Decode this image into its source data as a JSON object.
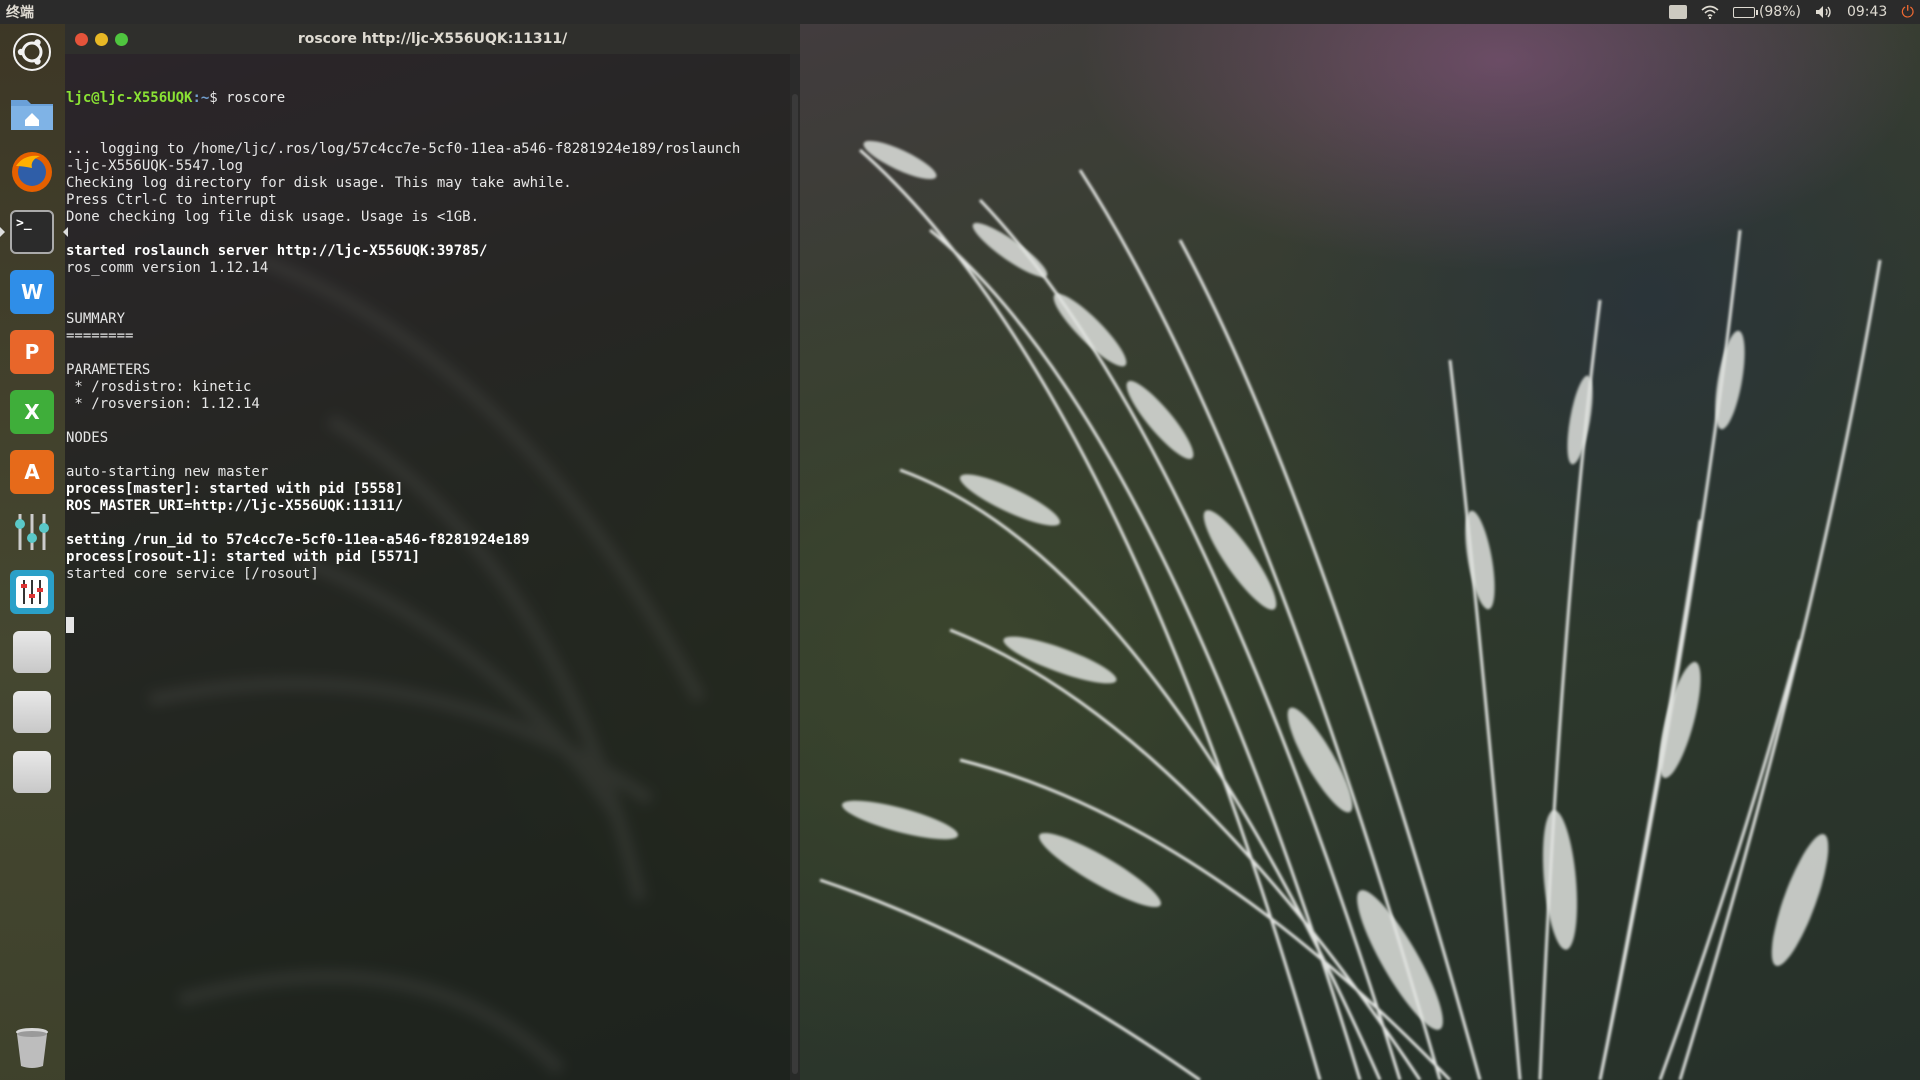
{
  "top_panel": {
    "app_name": "终端",
    "battery": "(98%)",
    "battery_fraction": 0.98,
    "clock": "09:43",
    "icons": [
      "keyboard-icon",
      "wifi-icon",
      "battery-icon",
      "volume-icon",
      "power-icon"
    ]
  },
  "launcher": {
    "items": [
      {
        "name": "ubuntu-dash",
        "icon": "ubuntu-logo-icon"
      },
      {
        "name": "files",
        "icon": "home-folder-icon"
      },
      {
        "name": "firefox",
        "icon": "firefox-icon"
      },
      {
        "name": "terminal",
        "icon": "terminal-icon",
        "label": ">_",
        "active": true
      },
      {
        "name": "libreoffice-writer",
        "icon": "writer-icon",
        "label": "W"
      },
      {
        "name": "libreoffice-impress",
        "icon": "impress-icon",
        "label": "P"
      },
      {
        "name": "libreoffice-calc",
        "icon": "calc-icon",
        "label": "X"
      },
      {
        "name": "software-center",
        "icon": "software-center-icon",
        "label": "A"
      },
      {
        "name": "system-settings",
        "icon": "sliders-icon"
      },
      {
        "name": "mixer",
        "icon": "mixer-icon"
      },
      {
        "name": "drive-1",
        "icon": "drive-icon"
      },
      {
        "name": "drive-2",
        "icon": "drive-icon"
      },
      {
        "name": "drive-3",
        "icon": "drive-icon"
      },
      {
        "name": "trash",
        "icon": "trash-icon"
      }
    ]
  },
  "terminal": {
    "title": "roscore http://ljc-X556UQK:11311/",
    "prompt_user": "ljc@ljc-X556UQK",
    "prompt_path": ":~",
    "prompt_cmd": "$ roscore",
    "lines": [
      {
        "text": "... logging to /home/ljc/.ros/log/57c4cc7e-5cf0-11ea-a546-f8281924e189/roslaunch",
        "bold": false
      },
      {
        "text": "-ljc-X556UQK-5547.log",
        "bold": false
      },
      {
        "text": "Checking log directory for disk usage. This may take awhile.",
        "bold": false
      },
      {
        "text": "Press Ctrl-C to interrupt",
        "bold": false
      },
      {
        "text": "Done checking log file disk usage. Usage is <1GB.",
        "bold": false
      },
      {
        "text": "",
        "bold": false
      },
      {
        "text": "started roslaunch server http://ljc-X556UQK:39785/",
        "bold": true
      },
      {
        "text": "ros_comm version 1.12.14",
        "bold": false
      },
      {
        "text": "",
        "bold": false
      },
      {
        "text": "",
        "bold": false
      },
      {
        "text": "SUMMARY",
        "bold": false
      },
      {
        "text": "========",
        "bold": false
      },
      {
        "text": "",
        "bold": false
      },
      {
        "text": "PARAMETERS",
        "bold": false
      },
      {
        "text": " * /rosdistro: kinetic",
        "bold": false
      },
      {
        "text": " * /rosversion: 1.12.14",
        "bold": false
      },
      {
        "text": "",
        "bold": false
      },
      {
        "text": "NODES",
        "bold": false
      },
      {
        "text": "",
        "bold": false
      },
      {
        "text": "auto-starting new master",
        "bold": false
      },
      {
        "text": "process[master]: started with pid [5558]",
        "bold": true
      },
      {
        "text": "ROS_MASTER_URI=http://ljc-X556UQK:11311/",
        "bold": true
      },
      {
        "text": "",
        "bold": false
      },
      {
        "text": "setting /run_id to 57c4cc7e-5cf0-11ea-a546-f8281924e189",
        "bold": true
      },
      {
        "text": "process[rosout-1]: started with pid [5571]",
        "bold": true
      },
      {
        "text": "started core service [/rosout]",
        "bold": false
      }
    ]
  }
}
